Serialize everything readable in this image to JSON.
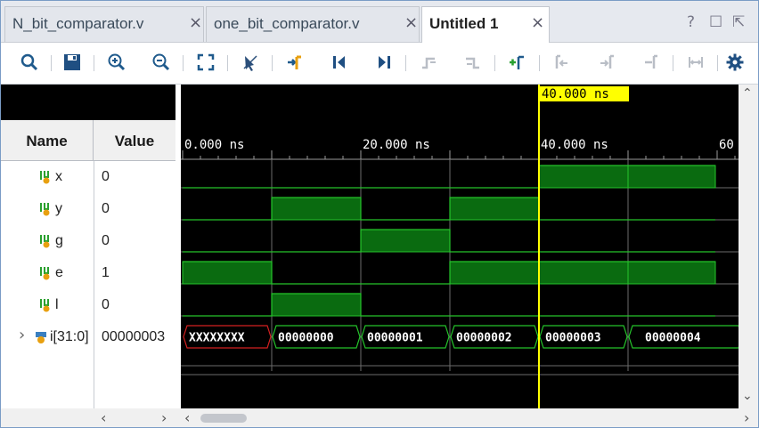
{
  "tabs": [
    {
      "label": "N_bit_comparator.v",
      "active": false
    },
    {
      "label": "one_bit_comparator.v",
      "active": false
    },
    {
      "label": "Untitled 1",
      "active": true
    }
  ],
  "tab_close_glyph": "×",
  "window_controls": [
    "?",
    "☐",
    "⇱"
  ],
  "toolbar": [
    "zoom-icon",
    "save-icon",
    "zoom-in-icon",
    "zoom-out-icon",
    "zoom-fit-icon",
    "cursor-icon",
    "go-to-cursor-icon",
    "go-to-start-icon",
    "go-to-end-icon",
    "previous-transition-icon",
    "next-transition-icon",
    "add-marker-icon",
    "previous-marker-icon",
    "next-marker-icon",
    "swap-cursors-icon",
    "snap-icon",
    "settings-gear-icon"
  ],
  "headers": {
    "name": "Name",
    "value": "Value"
  },
  "signals": [
    {
      "name": "x",
      "value": "0"
    },
    {
      "name": "y",
      "value": "0"
    },
    {
      "name": "g",
      "value": "0"
    },
    {
      "name": "e",
      "value": "1"
    },
    {
      "name": "l",
      "value": "0"
    },
    {
      "name": "i[31:0]",
      "value": "00000003"
    }
  ],
  "cursor": {
    "label": "40.000 ns",
    "time_ns": 40
  },
  "timeline": {
    "ticks": [
      {
        "label": "0.000 ns",
        "t": 0
      },
      {
        "label": "20.000 ns",
        "t": 20
      },
      {
        "label": "40.000 ns",
        "t": 40
      },
      {
        "label": "60",
        "t": 60
      }
    ]
  },
  "waveform": {
    "time_per_segment_ns": 10,
    "x": [
      0,
      0,
      0,
      0,
      1,
      1
    ],
    "y": [
      0,
      1,
      0,
      1,
      0,
      0
    ],
    "g": [
      0,
      0,
      1,
      0,
      0,
      0
    ],
    "e": [
      1,
      0,
      0,
      1,
      1,
      1
    ],
    "l": [
      0,
      1,
      0,
      0,
      0,
      0
    ],
    "i": [
      "XXXXXXXX",
      "00000000",
      "00000001",
      "00000002",
      "00000003",
      "00000004"
    ]
  },
  "colors": {
    "wave_high_fill": "#0a6b10",
    "wave_line": "#25c42b",
    "cursor": "#ffff00",
    "bus_unknown": "#d42020",
    "grid": "#6b6b6b",
    "text": "#ffffff"
  }
}
